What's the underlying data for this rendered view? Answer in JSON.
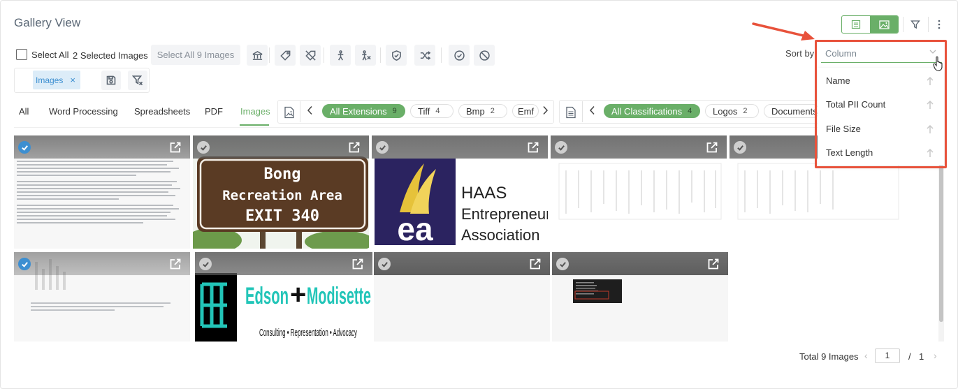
{
  "page": {
    "title": "Gallery View"
  },
  "toolbar": {
    "select_all_label": "Select All",
    "selected_count": "2 Selected Images",
    "select_all_images_button": "Select All 9 Images",
    "sort_label": "Sort by",
    "sort_placeholder": "Column"
  },
  "active_filters": [
    {
      "label": "Images",
      "remove_glyph": "×"
    }
  ],
  "tabs": [
    {
      "label": "All"
    },
    {
      "label": "Word Processing"
    },
    {
      "label": "Spreadsheets"
    },
    {
      "label": "PDF"
    },
    {
      "label": "Images",
      "active": true
    }
  ],
  "extension_filters": [
    {
      "label": "All Extensions",
      "count": "9",
      "active": true
    },
    {
      "label": "Tiff",
      "count": "4"
    },
    {
      "label": "Bmp",
      "count": "2"
    },
    {
      "label": "Emf",
      "count": ""
    }
  ],
  "classification_filters": [
    {
      "label": "All Classifications",
      "count": "4",
      "active": true
    },
    {
      "label": "Logos",
      "count": "2"
    },
    {
      "label": "Documents",
      "count": ""
    }
  ],
  "sort_options": [
    {
      "label": "Name"
    },
    {
      "label": "Total PII Count"
    },
    {
      "label": "File Size"
    },
    {
      "label": "Text Length"
    }
  ],
  "cards": {
    "sign": {
      "line1": "Bong",
      "line2": "Recreation Area",
      "line3": "EXIT  340"
    },
    "haas": {
      "mark": "ea",
      "line1": "HAAS",
      "line2": "Entrepreneurs",
      "line3": "Association"
    },
    "edson": {
      "line1": "Edson",
      "plus": "+",
      "line2": "Modisette",
      "line3": "Consulting • Representation • Advocacy"
    }
  },
  "footer": {
    "total": "Total 9 Images",
    "current_page": "1",
    "separator": "/",
    "total_pages": "1",
    "prev": "‹",
    "next": "›"
  },
  "colors": {
    "accent": "#6aaf68",
    "selected": "#3d8fd1",
    "annotation": "#e8523b"
  }
}
